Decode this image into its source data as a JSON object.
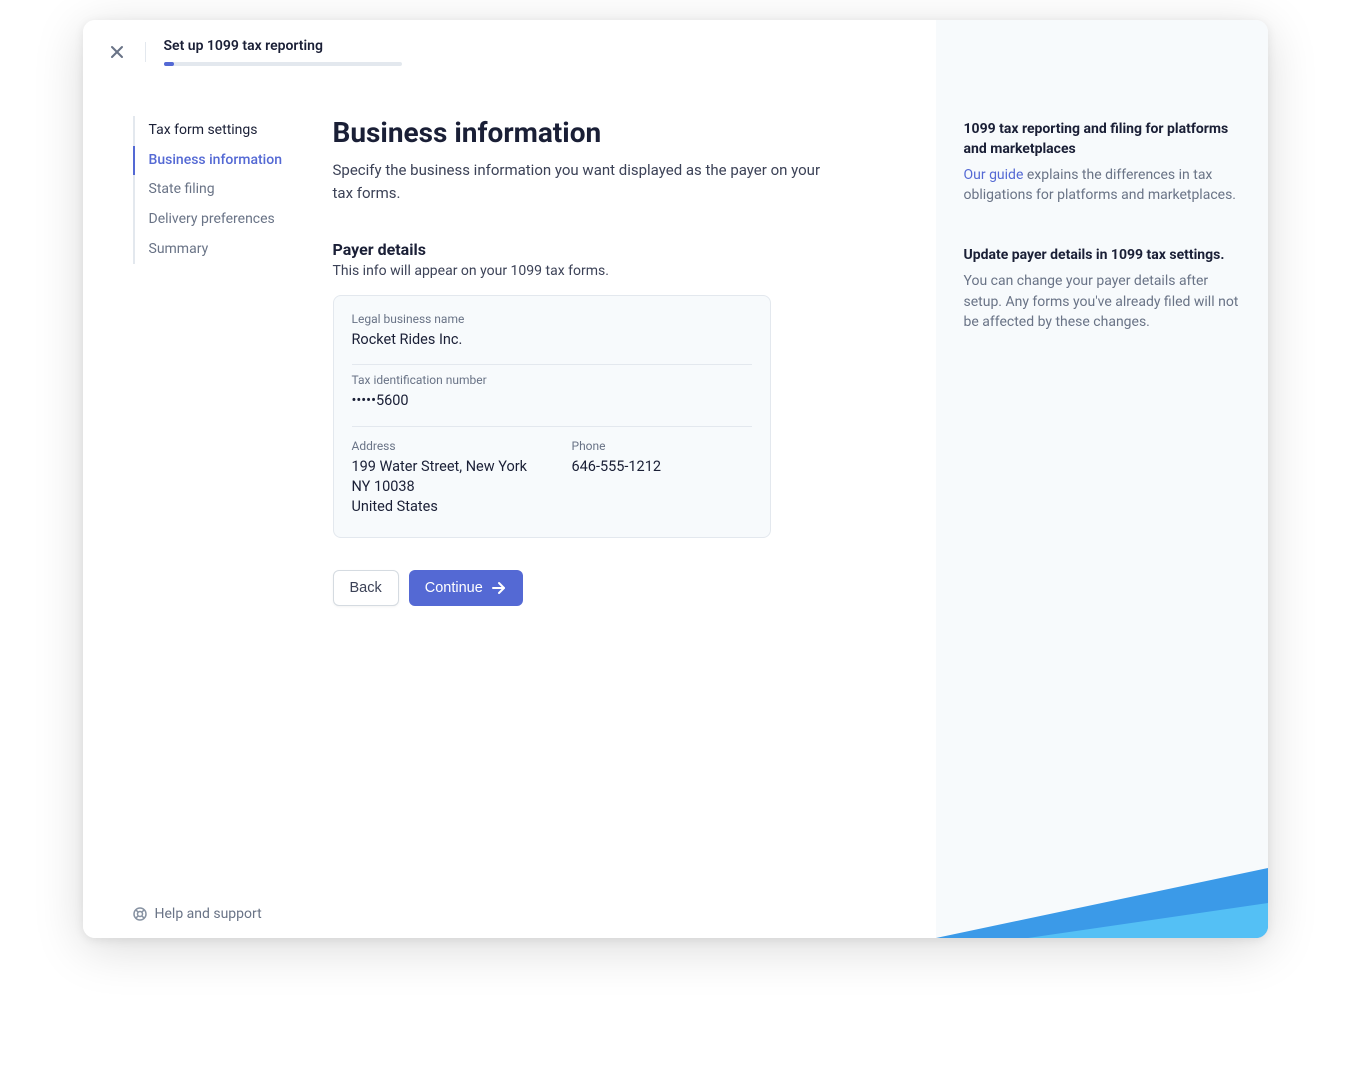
{
  "header": {
    "title": "Set up 1099 tax reporting"
  },
  "sidebar": {
    "items": [
      {
        "label": "Tax form settings"
      },
      {
        "label": "Business information"
      },
      {
        "label": "State filing"
      },
      {
        "label": "Delivery preferences"
      },
      {
        "label": "Summary"
      }
    ]
  },
  "main": {
    "title": "Business information",
    "description": "Specify the business information you want displayed as the payer on your tax forms.",
    "section_title": "Payer details",
    "section_desc": "This info will appear on your 1099 tax forms.",
    "details": {
      "legal_name_label": "Legal business name",
      "legal_name_value": "Rocket Rides Inc.",
      "tin_label": "Tax identification number",
      "tin_value": "•••••5600",
      "address_label": "Address",
      "address_line1": "199 Water Street, New York",
      "address_line2": "NY 10038",
      "address_line3": "United States",
      "phone_label": "Phone",
      "phone_value": "646-555-1212"
    },
    "back_label": "Back",
    "continue_label": "Continue"
  },
  "footer": {
    "help_label": "Help and support"
  },
  "right": {
    "block1": {
      "title": "1099 tax reporting and filing for platforms and marketplaces",
      "link": "Our guide",
      "text": " explains the differences in tax obligations for platforms and marketplaces."
    },
    "block2": {
      "title": "Update payer details in 1099 tax settings.",
      "text": "You can change your payer details after setup. Any forms you've already filed will not be affected by these changes."
    }
  }
}
